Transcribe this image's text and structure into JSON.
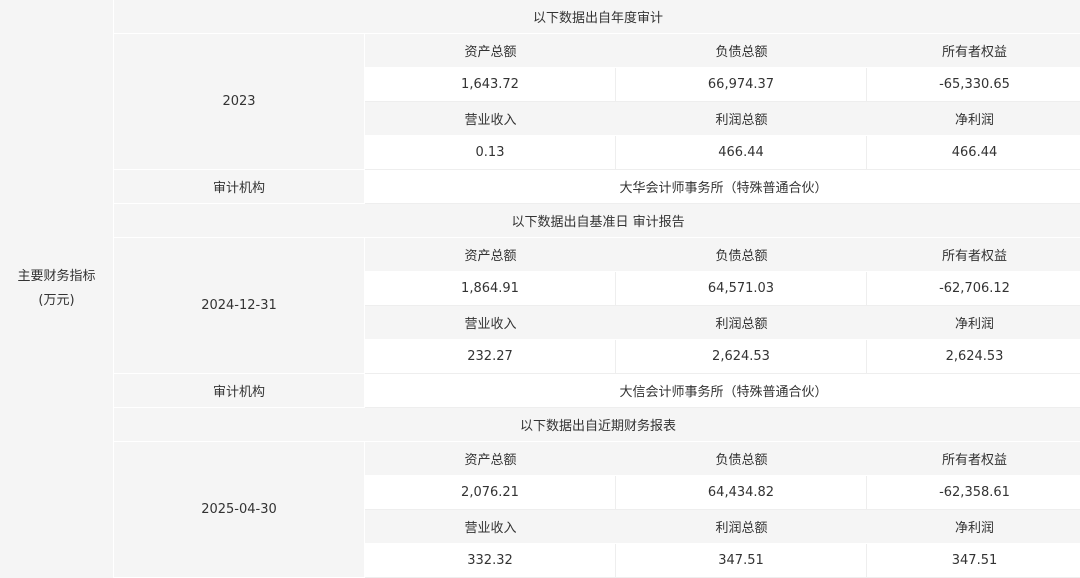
{
  "main_indicator_label": [
    "主要财务指标",
    "(万元)"
  ],
  "headers": {
    "assets": "资产总额",
    "liabilities": "负债总额",
    "equity": "所有者权益",
    "revenue": "营业收入",
    "total_profit": "利润总额",
    "net_profit": "净利润"
  },
  "audit_agency_label": "审计机构",
  "sections": [
    {
      "source_title": "以下数据出自年度审计",
      "period": "2023",
      "assets": "1,643.72",
      "liabilities": "66,974.37",
      "equity": "-65,330.65",
      "revenue": "0.13",
      "total_profit": "466.44",
      "net_profit": "466.44",
      "audit_agency": "大华会计师事务所（特殊普通合伙）"
    },
    {
      "source_title": "以下数据出自基准日 审计报告",
      "period": "2024-12-31",
      "assets": "1,864.91",
      "liabilities": "64,571.03",
      "equity": "-62,706.12",
      "revenue": "232.27",
      "total_profit": "2,624.53",
      "net_profit": "2,624.53",
      "audit_agency": "大信会计师事务所（特殊普通合伙）"
    },
    {
      "source_title": "以下数据出自近期财务报表",
      "period": "2025-04-30",
      "assets": "2,076.21",
      "liabilities": "64,434.82",
      "equity": "-62,358.61",
      "revenue": "332.32",
      "total_profit": "347.51",
      "net_profit": "347.51"
    }
  ]
}
